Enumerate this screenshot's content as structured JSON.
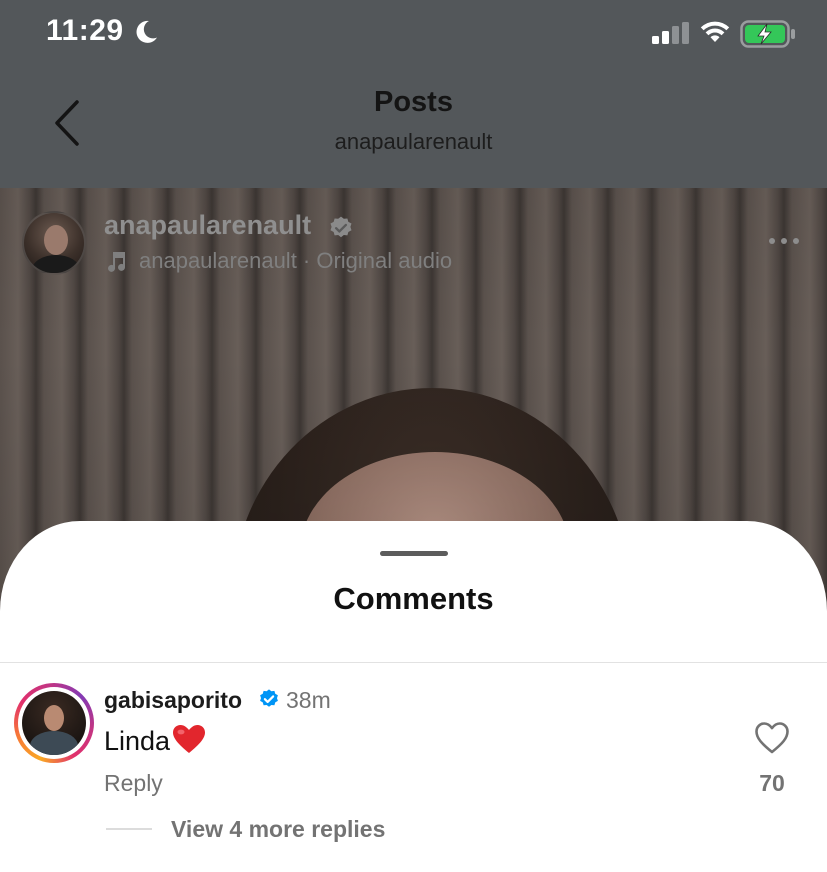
{
  "status_bar": {
    "time": "11:29",
    "moon_icon": "moon-icon",
    "signal_icon": "cellular-signal-icon",
    "wifi_icon": "wifi-icon",
    "battery_icon": "battery-charging-icon",
    "battery_color": "#34c759"
  },
  "header": {
    "back_icon": "chevron-left-icon",
    "title": "Posts",
    "subtitle": "anapaularenault"
  },
  "post": {
    "username": "anapaularenault",
    "verified_icon": "verified-badge-icon",
    "audio_label": "anapaularenault · Original audio",
    "music_icon": "music-note-icon",
    "more_icon": "more-options-icon"
  },
  "comments_sheet": {
    "title": "Comments",
    "comments": [
      {
        "username": "gabisaporito",
        "verified_icon": "verified-badge-icon",
        "verified_color": "#0095f6",
        "time": "38m",
        "text": "Linda",
        "emoji": "red-heart-emoji",
        "reply_label": "Reply",
        "like_icon": "heart-outline-icon",
        "like_count": "70",
        "view_replies_label": "View 4 more replies"
      }
    ]
  }
}
